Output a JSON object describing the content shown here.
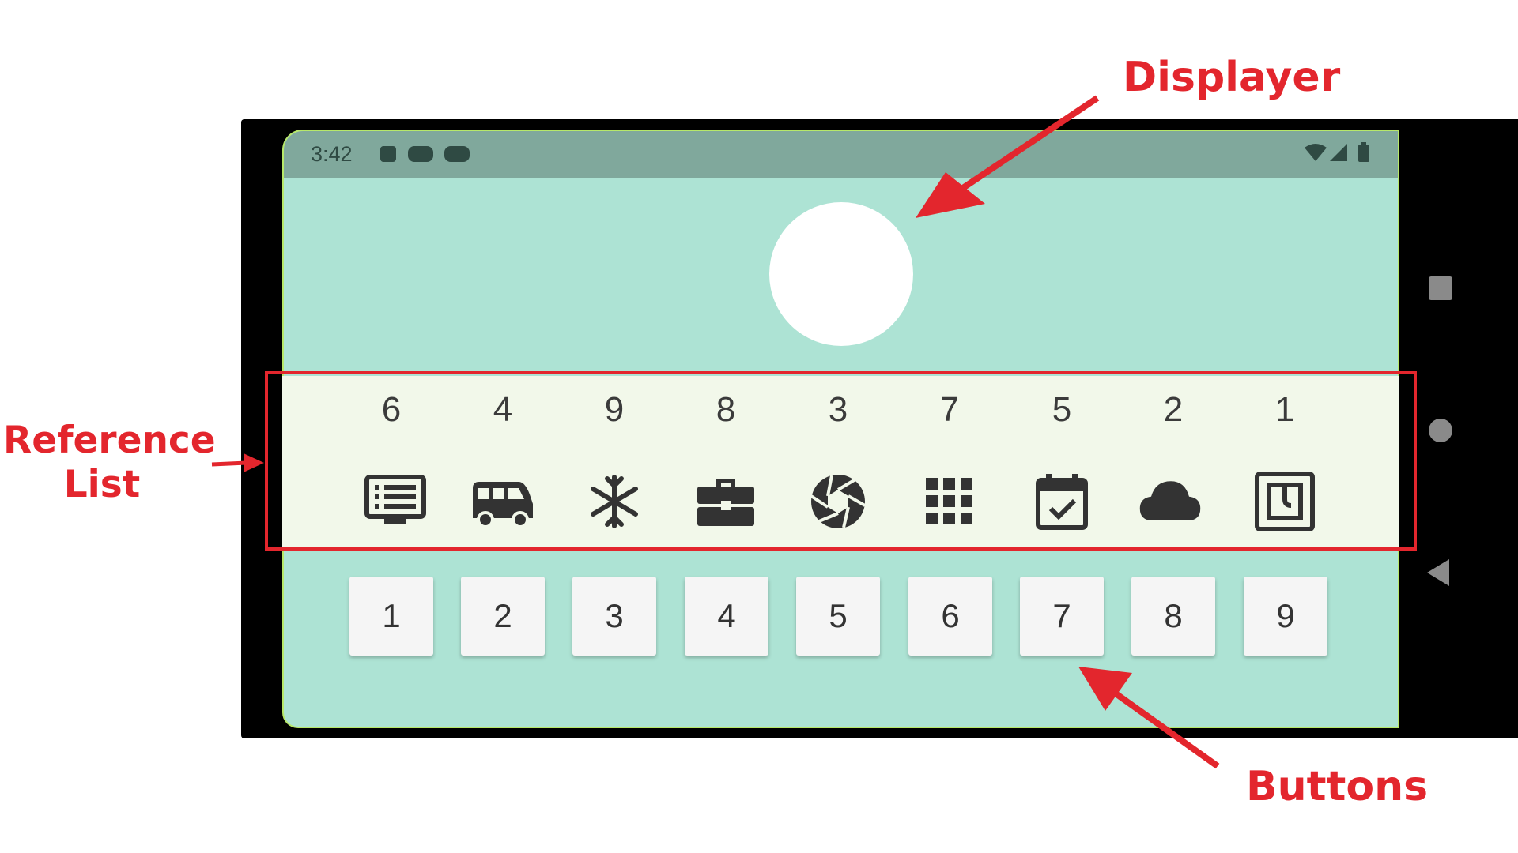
{
  "status_bar": {
    "time": "3:42",
    "left_icons": [
      "text-icon",
      "youtube-icon",
      "youtube-icon"
    ],
    "right_icons": [
      "wifi-icon",
      "signal-icon",
      "battery-icon"
    ]
  },
  "displayer": {
    "color": "#ffffff"
  },
  "reference_list": {
    "numbers": [
      "6",
      "4",
      "9",
      "8",
      "3",
      "7",
      "5",
      "2",
      "1"
    ],
    "icons": [
      "list-monitor-icon",
      "bus-icon",
      "snowflake-icon",
      "briefcase-icon",
      "camera-aperture-icon",
      "grid-apps-icon",
      "calendar-check-icon",
      "cloud-icon",
      "nfc-icon"
    ]
  },
  "buttons": {
    "labels": [
      "1",
      "2",
      "3",
      "4",
      "5",
      "6",
      "7",
      "8",
      "9"
    ]
  },
  "annotations": {
    "displayer": "Displayer",
    "reference_list_line1": "Reference",
    "reference_list_line2": "List",
    "buttons": "Buttons"
  },
  "colors": {
    "annotation_red": "#e3262d",
    "screen_bg": "#ade3d4",
    "status_bar_bg": "#80a89c",
    "reference_panel_bg": "#f2f8ea",
    "icon_dark": "#333333"
  }
}
